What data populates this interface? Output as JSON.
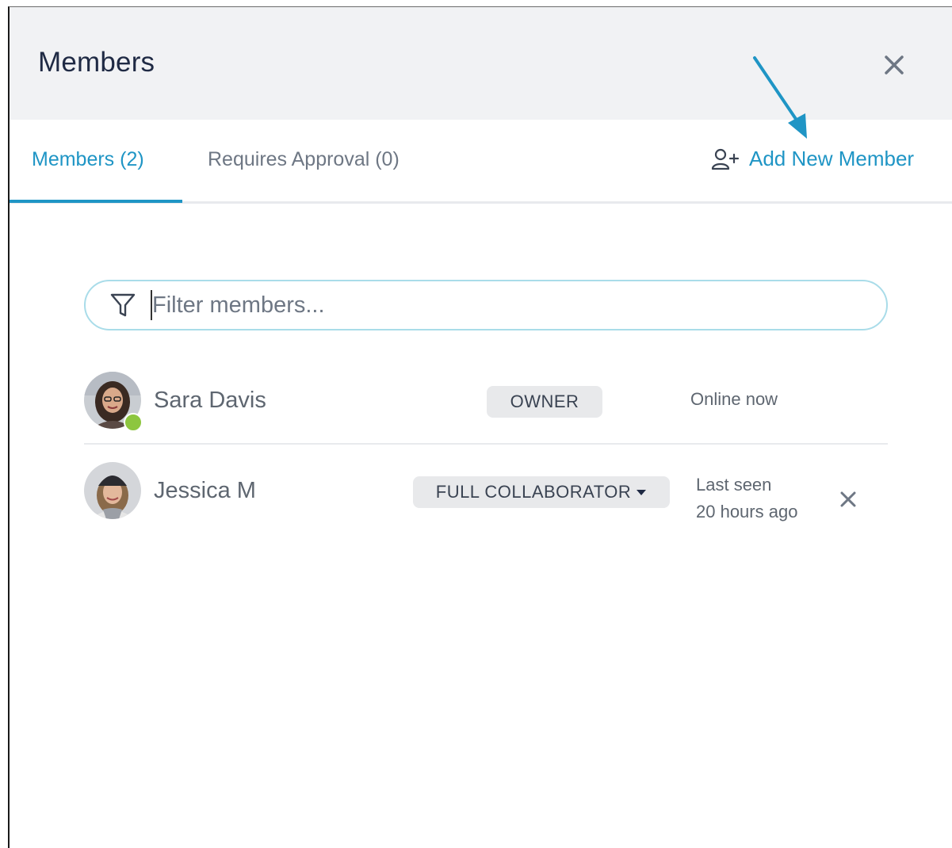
{
  "header": {
    "title": "Members",
    "close_icon": "close-icon"
  },
  "tabs": [
    {
      "label": "Members (2)",
      "active": true
    },
    {
      "label": "Requires Approval (0)",
      "active": false
    }
  ],
  "add_member": {
    "label": "Add New Member",
    "icon": "add-user-icon"
  },
  "filter": {
    "placeholder": "Filter members...",
    "value": "",
    "icon": "filter-icon"
  },
  "members": [
    {
      "name": "Sara Davis",
      "role": "OWNER",
      "status": "Online now",
      "online": true
    },
    {
      "name": "Jessica M",
      "role": "FULL COLLABORATOR",
      "status_line1": "Last seen",
      "status_line2": "20 hours ago",
      "online": false
    }
  ],
  "colors": {
    "accent": "#1f95c5",
    "header_bg": "#f1f2f4",
    "online": "#8dc63f",
    "badge_bg": "#e8e9eb"
  }
}
